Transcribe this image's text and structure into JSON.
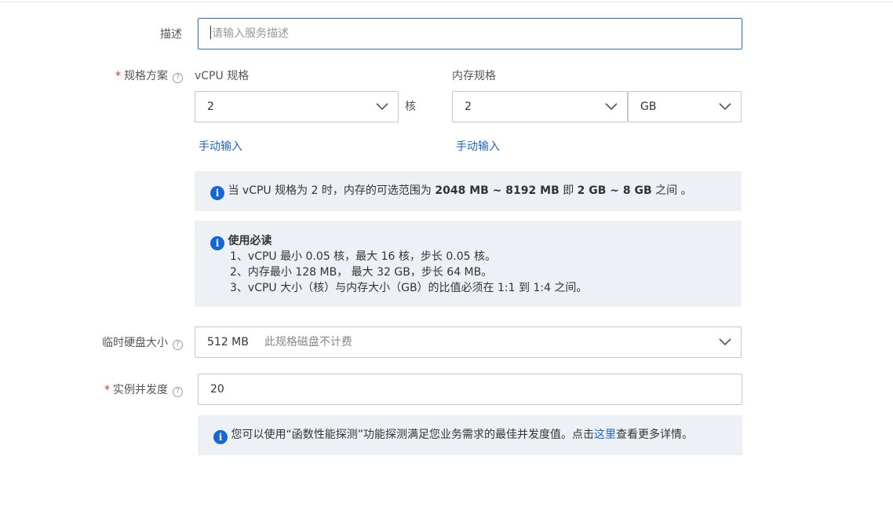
{
  "description": {
    "label": "描述",
    "placeholder": "请输入服务描述"
  },
  "spec": {
    "label": "规格方案",
    "help_icon": "question-circle-icon",
    "vcpu": {
      "label": "vCPU 规格",
      "value": "2",
      "unit": "核",
      "manual_link": "手动输入"
    },
    "memory": {
      "label": "内存规格",
      "value": "2",
      "unit_value": "GB",
      "manual_link": "手动输入"
    },
    "range_notice": {
      "icon": "info-icon",
      "prefix": "当 vCPU 规格为 2 时，内存的可选范围为 ",
      "mb_range": "2048 MB ~ 8192 MB",
      "middle": " 即 ",
      "gb_range": "2 GB ~ 8 GB",
      "suffix": " 之间 。"
    },
    "usage_notice": {
      "icon": "info-icon",
      "title": "使用必读",
      "lines": [
        "1、vCPU 最小 0.05 核，最大 16 核，步长 0.05 核。",
        "2、内存最小 128 MB， 最大 32 GB，步长 64 MB。",
        "3、vCPU 大小（核）与内存大小（GB）的比值必须在 1:1 到 1:4 之间。"
      ]
    }
  },
  "temp_disk": {
    "label": "临时硬盘大小",
    "help_icon": "question-circle-icon",
    "value": "512 MB",
    "hint": "此规格磁盘不计费"
  },
  "concurrency": {
    "label": "实例并发度",
    "help_icon": "question-circle-icon",
    "value": "20",
    "notice": {
      "icon": "info-icon",
      "prefix": "您可以使用“函数性能探测”功能探测满足您业务需求的最佳并发度值。点击",
      "link": "这里",
      "suffix": "查看更多详情。"
    }
  },
  "colors": {
    "accent": "#1f66c9",
    "info_icon": "#1567d6",
    "required": "#d93026",
    "notice_bg": "#edf1f5",
    "focus_border": "#3f7ed8"
  }
}
